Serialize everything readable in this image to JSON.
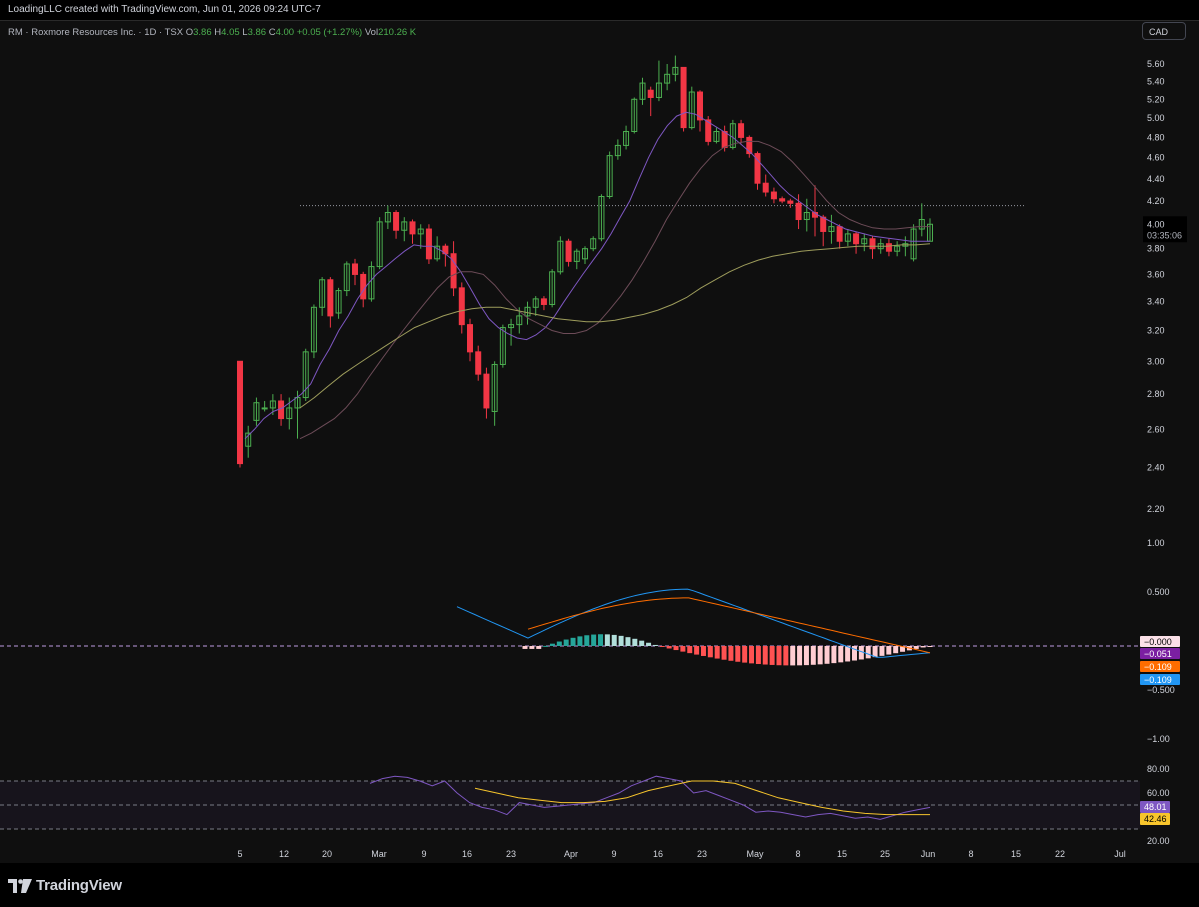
{
  "header": {
    "credit": "LoadingLLC created with TradingView.com, Jun 01, 2026 09:24 UTC-7"
  },
  "legend": {
    "symbol": "RM · Roxmore Resources Inc. · 1D · TSX",
    "o_label": "O",
    "o_value": "3.86",
    "h_label": "H",
    "h_value": "4.05",
    "l_label": "L",
    "l_value": "3.86",
    "c_label": "C",
    "c_value": "4.00",
    "change": "+0.05 (+1.27%)",
    "vol_label": "Vol",
    "vol_value": "210.26 K"
  },
  "currency_button": "CAD",
  "brand": "TradingView",
  "colors": {
    "up": "#4caf50",
    "down": "#f23645",
    "ma_fast": "#7e57c2",
    "ma_mid": "#5b3b3b",
    "ma_slow": "#9e9d5c",
    "macd": "#2196f3",
    "signal": "#ff6d00",
    "rsi": "#7e57c2",
    "rsi_ma": "#f7c52c"
  },
  "chart_data": [
    {
      "type": "candlestick",
      "title": "RM · Roxmore Resources Inc. · 1D · TSX",
      "scale": "log",
      "price_ticks": [
        "5.60",
        "5.40",
        "5.20",
        "5.00",
        "4.80",
        "4.60",
        "4.40",
        "4.20",
        "4.00",
        "3.80",
        "3.60",
        "3.40",
        "3.20",
        "3.00",
        "2.80",
        "2.60",
        "2.40",
        "2.20"
      ],
      "x_ticks": [
        "5",
        "12",
        "20",
        "Mar",
        "9",
        "16",
        "23",
        "Apr",
        "9",
        "16",
        "23",
        "May",
        "8",
        "15",
        "25",
        "Jun",
        "8",
        "15",
        "22",
        "Jul"
      ],
      "last_price": "4.00",
      "countdown": "03:35:06",
      "resistance_line": 4.16,
      "candles": [
        [
          3.0,
          2.42,
          2.4,
          3.0
        ],
        [
          2.51,
          2.58,
          2.45,
          2.62
        ],
        [
          2.65,
          2.75,
          2.62,
          2.78
        ],
        [
          2.72,
          2.72,
          2.7,
          2.76
        ],
        [
          2.72,
          2.76,
          2.68,
          2.8
        ],
        [
          2.76,
          2.66,
          2.62,
          2.8
        ],
        [
          2.66,
          2.72,
          2.6,
          2.78
        ],
        [
          2.72,
          2.78,
          2.55,
          2.82
        ],
        [
          2.78,
          3.06,
          2.76,
          3.08
        ],
        [
          3.06,
          3.36,
          3.02,
          3.38
        ],
        [
          3.36,
          3.56,
          3.3,
          3.58
        ],
        [
          3.56,
          3.3,
          3.22,
          3.58
        ],
        [
          3.32,
          3.48,
          3.28,
          3.5
        ],
        [
          3.48,
          3.68,
          3.44,
          3.7
        ],
        [
          3.68,
          3.6,
          3.52,
          3.72
        ],
        [
          3.6,
          3.42,
          3.36,
          3.62
        ],
        [
          3.42,
          3.66,
          3.4,
          3.7
        ],
        [
          3.66,
          4.02,
          3.64,
          4.06
        ],
        [
          4.02,
          4.1,
          3.96,
          4.16
        ],
        [
          4.1,
          3.95,
          3.88,
          4.12
        ],
        [
          3.95,
          4.02,
          3.86,
          4.06
        ],
        [
          4.02,
          3.92,
          3.84,
          4.04
        ],
        [
          3.92,
          3.96,
          3.8,
          4.0
        ],
        [
          3.96,
          3.72,
          3.68,
          4.0
        ],
        [
          3.72,
          3.82,
          3.7,
          3.9
        ],
        [
          3.82,
          3.76,
          3.66,
          3.84
        ],
        [
          3.76,
          3.5,
          3.44,
          3.86
        ],
        [
          3.5,
          3.24,
          3.18,
          3.54
        ],
        [
          3.24,
          3.06,
          3.0,
          3.28
        ],
        [
          3.06,
          2.92,
          2.88,
          3.1
        ],
        [
          2.92,
          2.72,
          2.66,
          2.96
        ],
        [
          2.7,
          2.98,
          2.62,
          3.0
        ],
        [
          2.98,
          3.22,
          2.96,
          3.24
        ],
        [
          3.22,
          3.24,
          3.1,
          3.28
        ],
        [
          3.24,
          3.3,
          3.18,
          3.36
        ],
        [
          3.3,
          3.36,
          3.24,
          3.4
        ],
        [
          3.36,
          3.42,
          3.3,
          3.44
        ],
        [
          3.42,
          3.38,
          3.34,
          3.44
        ],
        [
          3.38,
          3.62,
          3.36,
          3.64
        ],
        [
          3.62,
          3.86,
          3.6,
          3.9
        ],
        [
          3.86,
          3.7,
          3.66,
          3.88
        ],
        [
          3.7,
          3.78,
          3.64,
          3.8
        ],
        [
          3.72,
          3.8,
          3.68,
          3.82
        ],
        [
          3.8,
          3.88,
          3.78,
          3.9
        ],
        [
          3.88,
          4.24,
          3.86,
          4.26
        ],
        [
          4.24,
          4.62,
          4.22,
          4.66
        ],
        [
          4.62,
          4.72,
          4.58,
          4.78
        ],
        [
          4.72,
          4.86,
          4.68,
          4.92
        ],
        [
          4.86,
          5.2,
          4.84,
          5.22
        ],
        [
          5.2,
          5.38,
          5.14,
          5.44
        ],
        [
          5.3,
          5.22,
          5.02,
          5.34
        ],
        [
          5.22,
          5.38,
          5.18,
          5.64
        ],
        [
          5.38,
          5.48,
          5.3,
          5.6
        ],
        [
          5.48,
          5.56,
          5.4,
          5.7
        ],
        [
          5.56,
          4.9,
          4.86,
          5.48
        ],
        [
          4.9,
          5.28,
          4.88,
          5.34
        ],
        [
          5.28,
          4.98,
          4.86,
          5.3
        ],
        [
          4.98,
          4.76,
          4.72,
          5.02
        ],
        [
          4.76,
          4.86,
          4.74,
          4.9
        ],
        [
          4.86,
          4.7,
          4.66,
          4.92
        ],
        [
          4.7,
          4.94,
          4.68,
          4.98
        ],
        [
          4.94,
          4.8,
          4.74,
          4.98
        ],
        [
          4.8,
          4.64,
          4.6,
          4.82
        ],
        [
          4.64,
          4.36,
          4.3,
          4.66
        ],
        [
          4.36,
          4.28,
          4.24,
          4.44
        ],
        [
          4.28,
          4.22,
          4.18,
          4.32
        ],
        [
          4.22,
          4.2,
          4.18,
          4.24
        ],
        [
          4.2,
          4.18,
          4.14,
          4.22
        ],
        [
          4.18,
          4.04,
          3.96,
          4.26
        ],
        [
          4.04,
          4.1,
          3.94,
          4.22
        ],
        [
          4.1,
          4.06,
          3.9,
          4.34
        ],
        [
          4.06,
          3.94,
          3.82,
          4.08
        ],
        [
          3.94,
          3.98,
          3.84,
          4.08
        ],
        [
          3.98,
          3.86,
          3.8,
          4.0
        ],
        [
          3.86,
          3.92,
          3.82,
          3.96
        ],
        [
          3.92,
          3.84,
          3.76,
          3.94
        ],
        [
          3.84,
          3.88,
          3.78,
          3.92
        ],
        [
          3.88,
          3.8,
          3.72,
          3.9
        ],
        [
          3.8,
          3.84,
          3.76,
          3.88
        ],
        [
          3.84,
          3.78,
          3.74,
          3.88
        ],
        [
          3.78,
          3.82,
          3.74,
          3.86
        ],
        [
          3.82,
          3.84,
          3.74,
          3.9
        ],
        [
          3.72,
          3.96,
          3.7,
          4.0
        ],
        [
          3.96,
          4.04,
          3.9,
          4.18
        ],
        [
          3.86,
          4.0,
          3.86,
          4.05
        ]
      ],
      "ma_fast": [
        2.55,
        2.6,
        2.66,
        2.7,
        2.72,
        2.76,
        2.8,
        2.86,
        2.98,
        3.08,
        3.2,
        3.3,
        3.42,
        3.52,
        3.6,
        3.66,
        3.72,
        3.78,
        3.83,
        3.82,
        3.82,
        3.78,
        3.72,
        3.62,
        3.5,
        3.38,
        3.28,
        3.22,
        3.18,
        3.15,
        3.14,
        3.17,
        3.22,
        3.3,
        3.4,
        3.5,
        3.6,
        3.7,
        3.8,
        3.92,
        4.06,
        4.2,
        4.4,
        4.6,
        4.78,
        4.92,
        5.02,
        5.06,
        5.04,
        4.98,
        4.92,
        4.86,
        4.8,
        4.72,
        4.64,
        4.54,
        4.44,
        4.34,
        4.26,
        4.2,
        4.14,
        4.08,
        4.04,
        4.0,
        3.96,
        3.94,
        3.92,
        3.9,
        3.89,
        3.88,
        3.87,
        3.86,
        3.86,
        3.86
      ],
      "ma_mid": [
        2.55,
        2.58,
        2.62,
        2.66,
        2.72,
        2.8,
        2.9,
        3.0,
        3.1,
        3.2,
        3.3,
        3.4,
        3.5,
        3.58,
        3.62,
        3.62,
        3.6,
        3.52,
        3.42,
        3.34,
        3.28,
        3.24,
        3.2,
        3.18,
        3.18,
        3.2,
        3.25,
        3.34,
        3.44,
        3.56,
        3.7,
        3.86,
        4.04,
        4.2,
        4.36,
        4.5,
        4.62,
        4.7,
        4.74,
        4.76,
        4.76,
        4.72,
        4.66,
        4.56,
        4.44,
        4.32,
        4.2,
        4.1,
        4.04,
        4.0,
        3.97,
        3.96,
        3.96,
        3.97,
        3.98,
        3.98
      ],
      "ma_slow": [
        2.72,
        2.78,
        2.85,
        2.92,
        2.98,
        3.04,
        3.1,
        3.16,
        3.22,
        3.26,
        3.3,
        3.33,
        3.35,
        3.36,
        3.36,
        3.34,
        3.32,
        3.3,
        3.28,
        3.27,
        3.26,
        3.26,
        3.27,
        3.29,
        3.31,
        3.34,
        3.38,
        3.43,
        3.5,
        3.56,
        3.62,
        3.67,
        3.71,
        3.74,
        3.76,
        3.78,
        3.79,
        3.8,
        3.81,
        3.82,
        3.82,
        3.82,
        3.83,
        3.83,
        3.84
      ]
    },
    {
      "type": "macd",
      "y_ticks": [
        "1.00",
        "0.500",
        "−0.500",
        "−1.00"
      ],
      "values_shown": [
        "−0.000",
        "−0.051",
        "−0.109",
        "−0.109"
      ],
      "histogram_range": [
        -0.22,
        0.12
      ],
      "macd_peak": 0.52,
      "signal_peak": 0.44
    },
    {
      "type": "rsi",
      "y_ticks": [
        "80.00",
        "60.00",
        "20.00"
      ],
      "values_shown": [
        "48.01",
        "42.46"
      ],
      "upper_band": 70,
      "mid_band": 50,
      "lower_band": 30
    }
  ]
}
